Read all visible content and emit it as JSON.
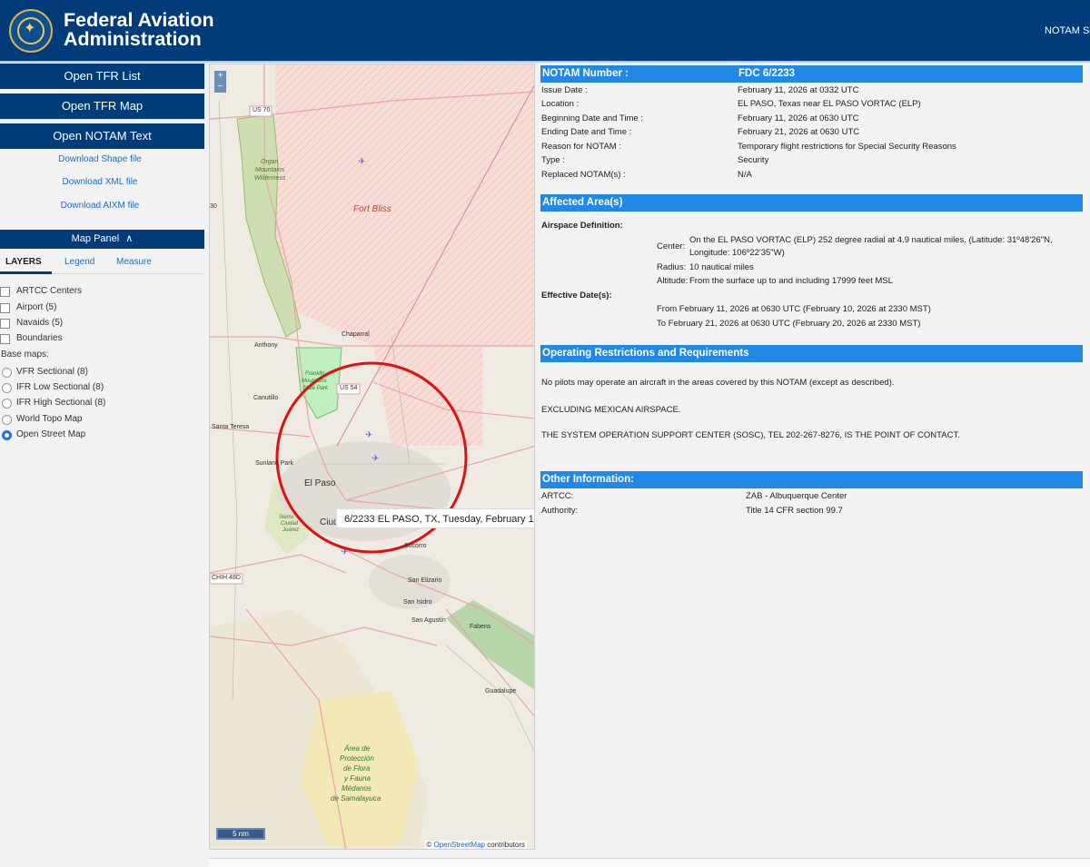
{
  "header": {
    "title_line1": "Federal Aviation",
    "title_line2": "Administration",
    "top_right": "NOTAM Se"
  },
  "left_panel": {
    "buttons": [
      "Open TFR List",
      "Open TFR Map",
      "Open NOTAM Text"
    ],
    "downloads": [
      "Download Shape file",
      "Download XML file",
      "Download AIXM file"
    ],
    "map_panel_label": "Map Panel",
    "map_panel_chevron": "∧",
    "tabs": [
      "LAYERS",
      "Legend",
      "Measure"
    ],
    "layers": [
      "ARTCC Centers",
      "Airport  (5)",
      "Navaids  (5)",
      "Boundaries"
    ],
    "basemaps_label": "Base maps:",
    "basemaps": [
      "VFR Sectional  (8)",
      "IFR Low Sectional  (8)",
      "IFR High Sectional  (8)",
      "World Topo Map",
      "Open Street Map"
    ],
    "selected_basemap": "Open Street Map"
  },
  "map": {
    "zoom_in": "+",
    "zoom_out": "−",
    "tooltip": "6/2233 EL PASO, TX, Tuesday, February 1",
    "scale": "5 nm",
    "attribution_prefix": "© ",
    "attribution_link": "OpenStreetMap",
    "attribution_suffix": " contributors",
    "labels": {
      "us70": "US 70",
      "organ": "Organ",
      "mountains": "Mountains",
      "wilderness": "Wilderness",
      "fort_bliss": "Fort Bliss",
      "chaparral": "Chaparral",
      "anthony": "Anthony",
      "franklin": "Franklin",
      "franklin2": "Mountains",
      "franklin3": "State Park",
      "us54": "US 54",
      "canutillo": "Canutillo",
      "santa_teresa": "Santa Teresa",
      "sunland": "Sunland Park",
      "el_paso": "El Paso",
      "ciudad": "Ciud",
      "sierra": "Sierra",
      "ciudad2": "Ciudad",
      "juarez": "Juárez",
      "chih": "CHIH 48D",
      "socorro": "Socorro",
      "san_elizario": "San Elizario",
      "san_isidro": "San Isidro",
      "san_agustin": "San Agustín",
      "fabens": "Fabens",
      "guadalupe": "Guadalupe",
      "area1": "Área de",
      "area2": "Protección",
      "area3": "de Flora",
      "area4": "y Fauna",
      "area5": "Médanos",
      "area6": "de Samalayuca",
      "d30": "30"
    },
    "colors": {
      "tfr_circle": "#e01010",
      "restricted_fill": "#f4d2c9",
      "park_green": "#c9dfa8",
      "state_park": "#b5e8b5",
      "road": "#e89a9a"
    }
  },
  "notam": {
    "number_label": "NOTAM Number :",
    "number_value": "FDC 6/2233",
    "rows": [
      {
        "label": "Issue Date :",
        "value": "February 11, 2026 at 0332 UTC"
      },
      {
        "label": "Location :",
        "value": "EL PASO, Texas near EL PASO VORTAC (ELP)"
      },
      {
        "label": "Beginning Date and Time :",
        "value": "February 11, 2026 at 0630 UTC"
      },
      {
        "label": "Ending Date and Time :",
        "value": "February 21, 2026 at 0630 UTC"
      },
      {
        "label": "Reason for NOTAM :",
        "value": "Temporary flight restrictions for Special Security Reasons"
      },
      {
        "label": "Type :",
        "value": "Security"
      },
      {
        "label": "Replaced NOTAM(s) :",
        "value": "N/A"
      }
    ],
    "affected_title": "Affected Area(s)",
    "airspace_def_label": "Airspace Definition:",
    "center_label": "Center:",
    "center_value_1": "On the EL PASO VORTAC (ELP) 252 degree radial at 4.9 nautical miles. (Latitude: 31º48'26\"N,",
    "center_value_2": "Longitude: 106º22'35\"W)",
    "radius_label": "Radius:",
    "radius_value": "10 nautical miles",
    "altitude_label": "Altitude:",
    "altitude_value": "From the surface up to and including 17999 feet MSL",
    "effective_label": "Effective Date(s):",
    "effective_from": "From February 11, 2026 at 0630 UTC (February 10, 2026 at 2330 MST)",
    "effective_to": "To February 21, 2026 at 0630 UTC (February 20, 2026 at 2330 MST)",
    "operating_title": "Operating Restrictions and Requirements",
    "op_text_1": "No pilots may operate an aircraft in the areas covered by this NOTAM (except as described).",
    "op_text_2": "EXCLUDING MEXICAN AIRSPACE.",
    "op_text_3": "THE SYSTEM OPERATION SUPPORT CENTER (SOSC), TEL 202-267-8276, IS THE POINT OF CONTACT.",
    "other_title": "Other Information:",
    "artcc_label": "ARTCC:",
    "artcc_value": "ZAB - Albuquerque Center",
    "authority_label": "Authority:",
    "authority_value": "Title 14 CFR section 99.7"
  }
}
